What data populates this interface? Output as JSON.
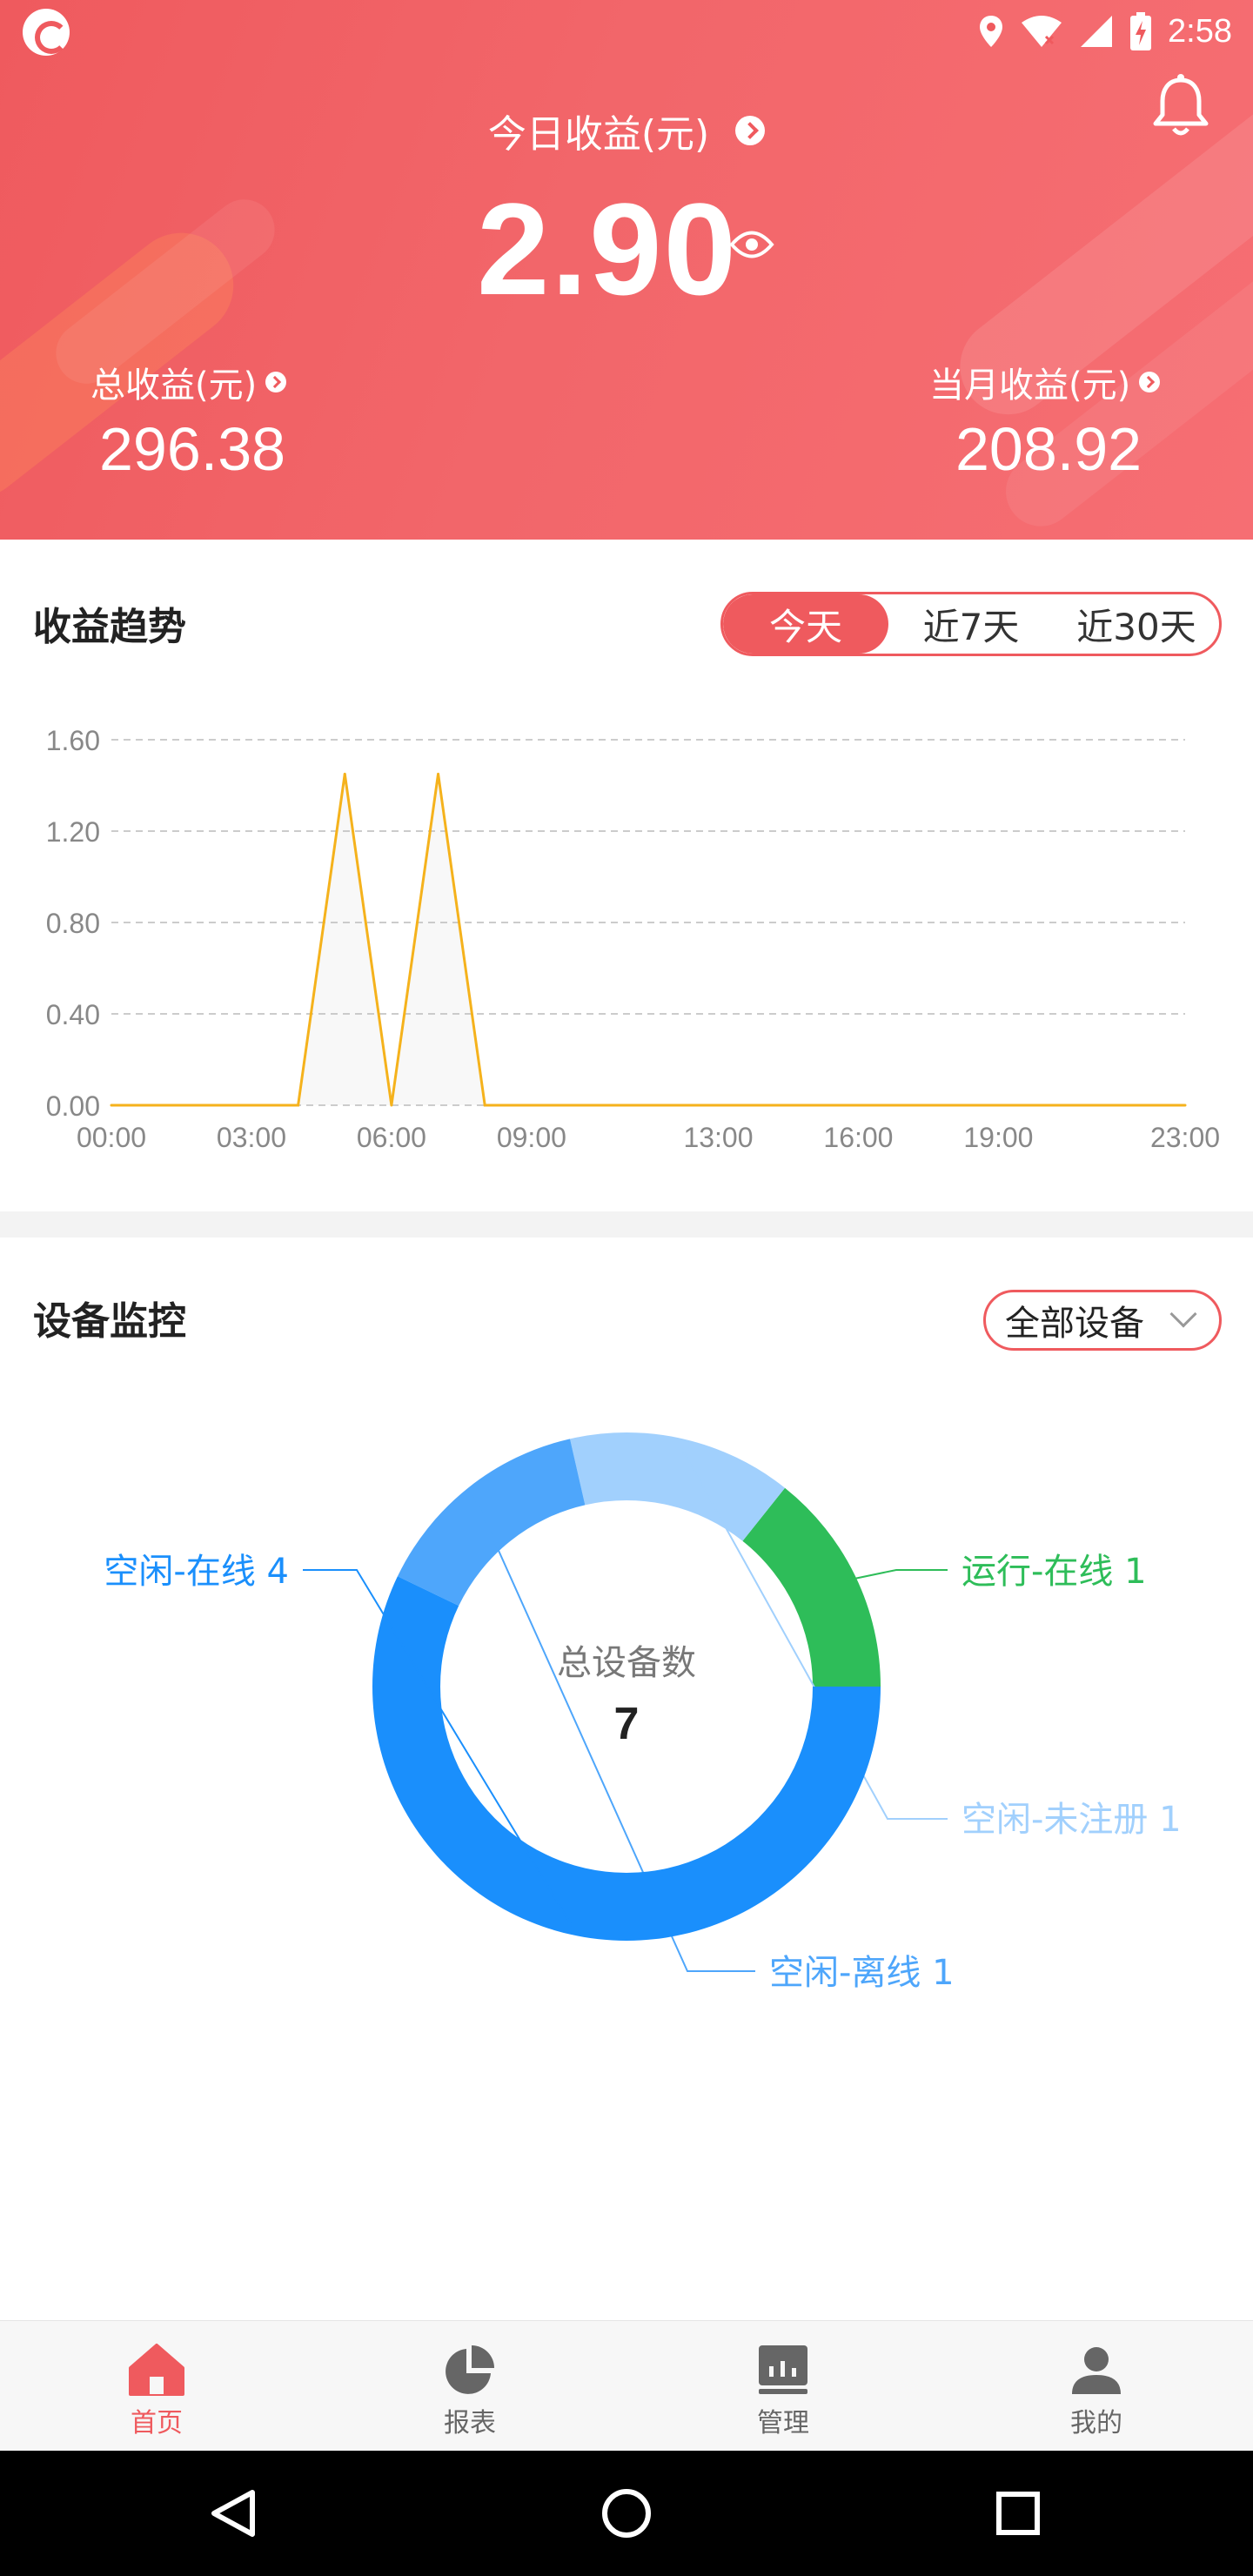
{
  "status_bar": {
    "time": "2:58"
  },
  "header": {
    "today_label": "今日收益(元)",
    "today_value": "2.90",
    "total_label": "总收益(元)",
    "total_value": "296.38",
    "month_label": "当月收益(元)",
    "month_value": "208.92"
  },
  "trend": {
    "title": "收益趋势",
    "tabs": [
      "今天",
      "近7天",
      "近30天"
    ],
    "active_tab": "今天"
  },
  "chart_data": {
    "type": "line",
    "x": [
      "00:00",
      "01:00",
      "02:00",
      "03:00",
      "04:00",
      "05:00",
      "06:00",
      "07:00",
      "08:00",
      "09:00",
      "10:00",
      "11:00",
      "12:00",
      "13:00",
      "14:00",
      "15:00",
      "16:00",
      "17:00",
      "18:00",
      "19:00",
      "20:00",
      "21:00",
      "22:00",
      "23:00"
    ],
    "x_tick_labels": [
      "00:00",
      "03:00",
      "06:00",
      "09:00",
      "13:00",
      "16:00",
      "19:00",
      "23:00"
    ],
    "x_tick_indices": [
      0,
      3,
      6,
      9,
      13,
      16,
      19,
      23
    ],
    "values": [
      0,
      0,
      0,
      0,
      0,
      1.45,
      0,
      1.45,
      0,
      0,
      0,
      0,
      0,
      0,
      0,
      0,
      0,
      0,
      0,
      0,
      0,
      0,
      0,
      0
    ],
    "ylim": [
      0,
      1.6
    ],
    "y_ticks": [
      "0.00",
      "0.40",
      "0.80",
      "1.20",
      "1.60"
    ],
    "grid": true,
    "line_color": "#f5b21c"
  },
  "monitor": {
    "title": "设备监控",
    "filter_label": "全部设备",
    "center_label": "总设备数",
    "center_value": "7",
    "segments": [
      {
        "label": "运行-在线 1",
        "value": 1,
        "color": "#2ebd59"
      },
      {
        "label": "空闲-未注册 1",
        "value": 1,
        "color": "#a1d0fd"
      },
      {
        "label": "空闲-离线 1",
        "value": 1,
        "color": "#4ea6fb"
      },
      {
        "label": "空闲-在线 4",
        "value": 4,
        "color": "#1a8ffc"
      }
    ]
  },
  "tabbar": {
    "items": [
      {
        "label": "首页",
        "icon": "home-icon",
        "active": true
      },
      {
        "label": "报表",
        "icon": "pie-chart-icon",
        "active": false
      },
      {
        "label": "管理",
        "icon": "dashboard-icon",
        "active": false
      },
      {
        "label": "我的",
        "icon": "user-icon",
        "active": false
      }
    ]
  },
  "colors": {
    "accent": "#ef5a5e",
    "line": "#f5b21c",
    "running_online": "#2ebd59",
    "idle_unregistered": "#a1d0fd",
    "idle_offline": "#4ea6fb",
    "idle_online": "#1a8ffc"
  }
}
